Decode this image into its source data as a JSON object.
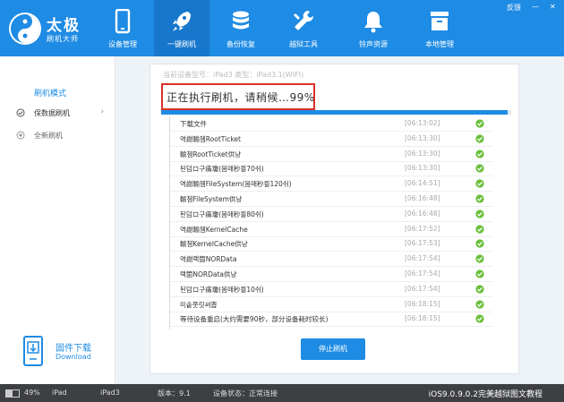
{
  "app": {
    "logo_title": "太极",
    "logo_subtitle": "刷机大师",
    "window_controls": {
      "feedback": "反馈",
      "minimize": "—",
      "close": "✕"
    }
  },
  "nav": [
    {
      "label": "设备管理",
      "icon": "phone-icon"
    },
    {
      "label": "一键刷机",
      "icon": "rocket-icon"
    },
    {
      "label": "备份恢复",
      "icon": "database-icon"
    },
    {
      "label": "越狱工具",
      "icon": "wrench-icon"
    },
    {
      "label": "铃声资源",
      "icon": "bell-icon"
    },
    {
      "label": "本地管理",
      "icon": "box-icon"
    }
  ],
  "sidebar": {
    "title": "刷机模式",
    "items": [
      {
        "label": "保数据刷机",
        "selected": true
      },
      {
        "label": "全新刷机",
        "selected": false
      }
    ],
    "firmware_download": {
      "label": "固件下载",
      "sublabel": "Download"
    }
  },
  "main": {
    "breadcrumb": "当前设备型号：iPad3 类型：iPad3.1(WIFI)",
    "status_text": "正在执行刷机，请稍候…99%",
    "progress_percent": 99,
    "log": [
      {
        "msg": "下载文件",
        "time": "[06:13:02]"
      },
      {
        "msg": "역謝輸쳄RootTicket",
        "time": "[06:13:30]"
      },
      {
        "msg": "輸쳄RootTicket供냥",
        "time": "[06:13:30]"
      },
      {
        "msg": "된덤ロ구痛瓊(몸매秒쾰70쉬)",
        "time": "[06:13:30]"
      },
      {
        "msg": "역謝輸쳄FileSystem(몸매秒쾰120쉬)",
        "time": "[06:14:51]"
      },
      {
        "msg": "輸쳄FileSystem供냥",
        "time": "[06:16:48]"
      },
      {
        "msg": "된덤ロ구痛瓊(몸매秒쾰80쉬)",
        "time": "[06:16:48]"
      },
      {
        "msg": "역謝輸쳄KernelCache",
        "time": "[06:17:52]"
      },
      {
        "msg": "輸쳄KernelCache供냥",
        "time": "[06:17:53]"
      },
      {
        "msg": "역謝랙箇NORData",
        "time": "[06:17:54]"
      },
      {
        "msg": "랙箇NORData供냥",
        "time": "[06:17:54]"
      },
      {
        "msg": "된덤ロ구痛瓊(몸매秒쾰10쉬)",
        "time": "[06:17:54]"
      },
      {
        "msg": "미솥쫏릿써뽑",
        "time": "[06:18:15]"
      },
      {
        "msg": "等待设备重启(大约需要90秒，部分设备耗时较长)",
        "time": "[06:18:15]"
      }
    ],
    "stop_button": "停止刷机"
  },
  "statusbar": {
    "battery": "49%",
    "device": "iPad",
    "model": "iPad3",
    "version": "版本：9.1",
    "state": "设备状态：正常连接",
    "promo": "iOS9.0.9.0.2完美越狱图文教程"
  },
  "colors": {
    "accent": "#1e8be4",
    "highlight_box": "#d9302a",
    "success_check": "#6abf3c",
    "statusbar_bg": "#3d3f42"
  }
}
